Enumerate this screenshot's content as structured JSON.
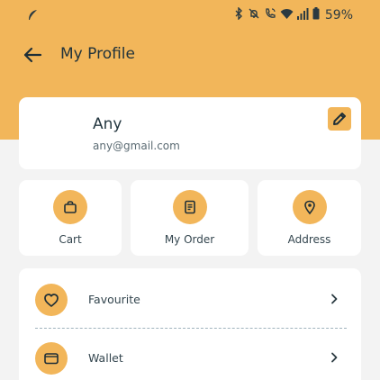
{
  "status_bar": {
    "battery": "59%",
    "icons": [
      "feather-icon",
      "bluetooth-icon",
      "mute-icon",
      "wifi-call-icon",
      "wifi-icon",
      "signal-icon",
      "battery-icon"
    ]
  },
  "appbar": {
    "title": "My Profile",
    "back_icon": "arrow-left-icon"
  },
  "profile": {
    "name": "Any",
    "email": "any@gmail.com",
    "edit_icon": "pencil-icon"
  },
  "quick_actions": [
    {
      "label": "Cart",
      "icon": "bag-icon"
    },
    {
      "label": "My Order",
      "icon": "receipt-icon"
    },
    {
      "label": "Address",
      "icon": "location-pin-icon"
    }
  ],
  "menu": [
    {
      "label": "Favourite",
      "icon": "heart-icon"
    },
    {
      "label": "Wallet",
      "icon": "wallet-icon"
    }
  ],
  "colors": {
    "accent": "#f2b65a",
    "background": "#f3f3f3",
    "card": "#ffffff",
    "text": "#2c3e47"
  }
}
